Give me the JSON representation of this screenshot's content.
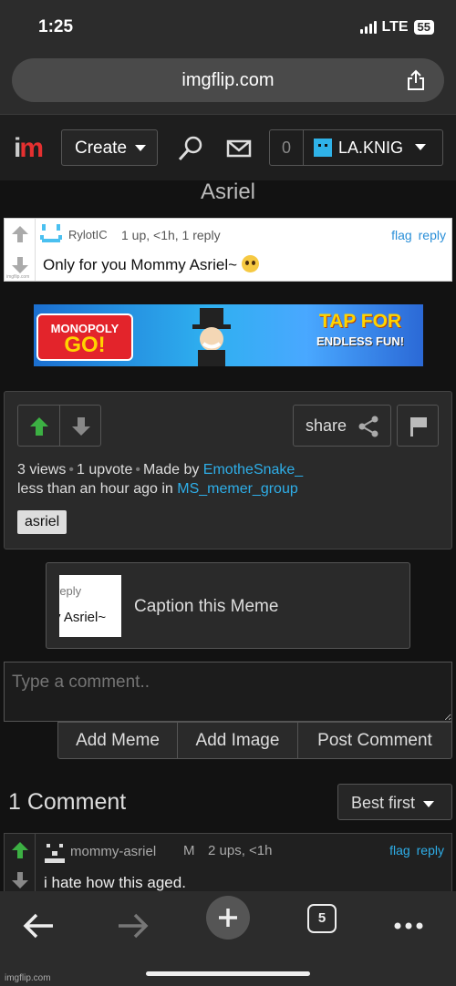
{
  "status_bar": {
    "time": "1:25",
    "network": "LTE",
    "battery": "55"
  },
  "browser": {
    "url": "imgflip.com",
    "tabs_count": "5"
  },
  "header": {
    "logo_i": "i",
    "logo_m": "m",
    "create_label": "Create",
    "notification_count": "0",
    "username": "LA.KNIG"
  },
  "page": {
    "title": "Asriel"
  },
  "top_comment": {
    "user": "RylotIC",
    "meta": "1 up, <1h, 1 reply",
    "flag": "flag",
    "reply": "reply",
    "text": "Only for you Mommy Asriel~",
    "image_credit": "imgflip.com"
  },
  "ad": {
    "brand_line1": "MONOPOLY",
    "brand_line2": "GO!",
    "tap_line1": "TAP FOR",
    "tap_line2": "ENDLESS FUN!"
  },
  "meme_info": {
    "share_label": "share",
    "views": "3 views",
    "upvotes": "1 upvote",
    "made_by_label": "Made by",
    "author": "EmotheSnake_",
    "time_label": "less than an hour ago in",
    "group": "MS_memer_group",
    "tag": "asriel"
  },
  "caption": {
    "thumb_line1": "reply",
    "thumb_line2": "y Asriel~",
    "label": "Caption this Meme"
  },
  "comment_form": {
    "placeholder": "Type a comment..",
    "add_meme": "Add Meme",
    "add_image": "Add Image",
    "post_comment": "Post Comment"
  },
  "comments_section": {
    "count_label": "1 Comment",
    "sort_label": "Best first"
  },
  "comment": {
    "user": "mommy-asriel",
    "badge": "M",
    "meta": "2 ups, <1h",
    "flag": "flag",
    "reply": "reply",
    "text": "i hate how this aged."
  },
  "footer": {
    "credit": "imgflip.com"
  },
  "colors": {
    "link": "#2eaee8",
    "upvote": "#3cb043",
    "logo_m": "#e53030",
    "avatar": "#2fb2e8"
  }
}
